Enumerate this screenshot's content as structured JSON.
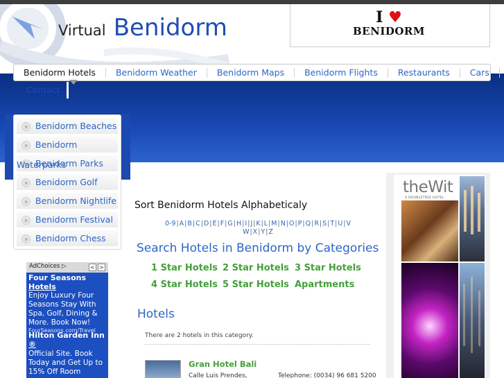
{
  "header": {
    "title_prefix": "Virtual",
    "title_main": "Benidorm",
    "love_logo_top": "I",
    "love_logo_bottom": "BENIDORM"
  },
  "nav": {
    "items": [
      {
        "label": "Benidorm Hotels",
        "active": true
      },
      {
        "label": "Benidorm Weather"
      },
      {
        "label": "Benidorm Maps"
      },
      {
        "label": "Benidorm Flights"
      },
      {
        "label": "Restaurants"
      },
      {
        "label": "Cars"
      }
    ],
    "contact": "Contact"
  },
  "sidebar": {
    "items": [
      {
        "label": "Benidorm Beaches"
      },
      {
        "label": "Benidorm"
      },
      {
        "label": "Benidorm Parks"
      },
      {
        "label": "Benidorm Golf"
      },
      {
        "label": "Benidorm Nightlife"
      },
      {
        "label": "Benidorm Festival"
      },
      {
        "label": "Benidorm Chess"
      }
    ],
    "overflow_word": "Waterparks"
  },
  "ad_left": {
    "adchoices": "AdChoices",
    "prev": "<",
    "next": ">",
    "ad1_title_line1": "Four Seasons",
    "ad1_title_line2": "Hotels",
    "ad1_body": [
      "Enjoy Luxury Four",
      "Seasons Stay With",
      "Spa, Golf, Dining &",
      "More. Book Now!"
    ],
    "ad1_url": "FourSeasons.com/Travel",
    "ad2_title_line1": "Hilton Garden Inn",
    "ad2_title_line2": "®",
    "ad2_body": [
      "Official Site. Book",
      "Today and Get Up to",
      "15% Off Room"
    ]
  },
  "main": {
    "sort_title": "Sort Benidorm Hotels Alphabeticaly",
    "alpha_row1": [
      "0-9",
      "A",
      "B",
      "C",
      "D",
      "E",
      "F",
      "G",
      "H",
      "I",
      "J",
      "K",
      "L",
      "M",
      "N",
      "O",
      "P",
      "Q",
      "R",
      "S",
      "T",
      "U",
      "V"
    ],
    "alpha_row2": [
      "W",
      "X",
      "Y",
      "Z"
    ],
    "categories_title": "Search Hotels in Benidorm by Categories",
    "categories": [
      "1 Star Hotels",
      "2 Star Hotels",
      "3 Star Hotels",
      "4 Star Hotels",
      "5 Star Hotels",
      "Apartments"
    ],
    "hotels_title": "Hotels",
    "hotels_count_text": "There are 2 hotels in this category.",
    "hotel": {
      "name": "Gran Hotel Bali",
      "address": "Calle Luis Prendes,",
      "telephone": "Telephone: (0034) 96 681 5200"
    }
  },
  "ad_right": {
    "brand": "theWit",
    "sub": "A DOUBLETREE HOTEL",
    "ad_icon": "▷"
  },
  "colors": {
    "link_blue": "#2c66c5",
    "title_blue": "#1e4db3",
    "category_green": "#44a03a",
    "banner_blue": "#1646b0"
  }
}
